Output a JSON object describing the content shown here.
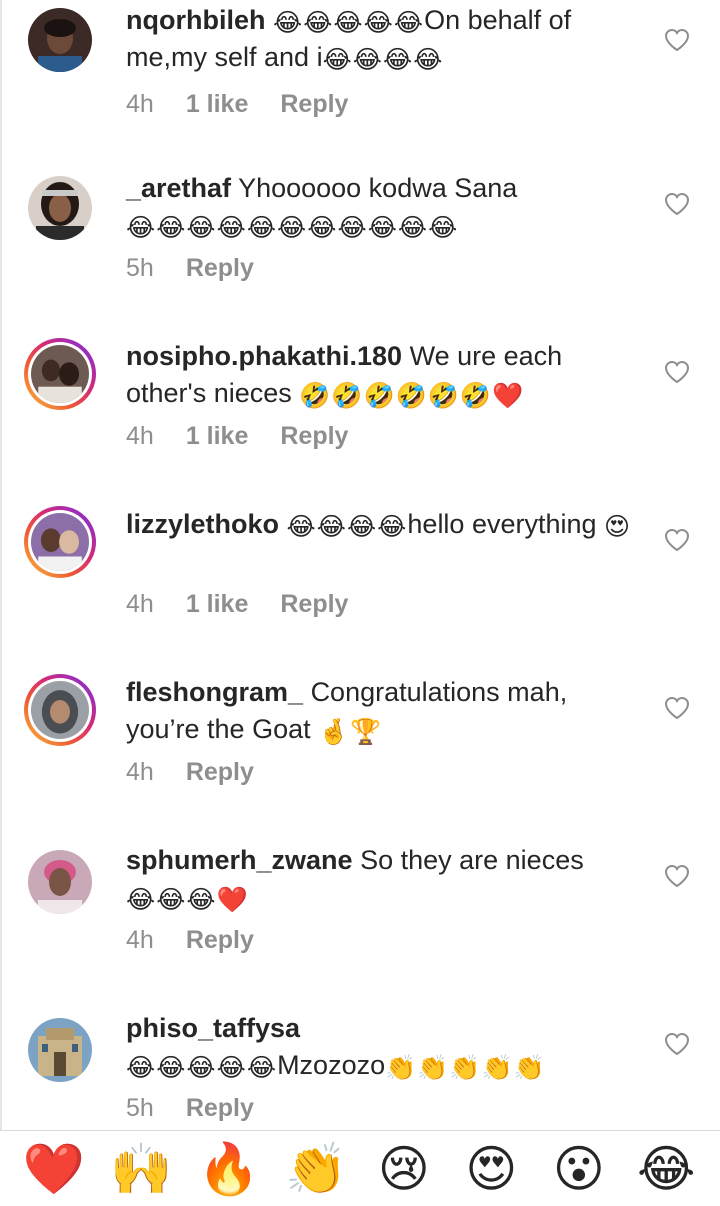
{
  "comments": [
    {
      "username": "nqorhbileh",
      "text_before": " ",
      "emoji_before": "😂😂😂😂😂",
      "text": "On behalf of me,my self and i",
      "emoji_after": "😂😂😂😂",
      "time": "4h",
      "likes": "1 like",
      "reply": "Reply",
      "avatar_icon": "avatar-woman-icon"
    },
    {
      "username": "_arethaf",
      "text_before": " ",
      "emoji_before": "",
      "text": "Yhoooooo kodwa Sana ",
      "emoji_after": "😂😂😂😂😂😂😂😂😂😂😂",
      "time": "5h",
      "likes": "",
      "reply": "Reply",
      "avatar_icon": "avatar-woman-icon"
    },
    {
      "username": "nosipho.phakathi.180",
      "text_before": " ",
      "emoji_before": "",
      "text": "We ure each other's nieces ",
      "emoji_after": "🤣🤣🤣🤣🤣🤣❤️",
      "time": "4h",
      "likes": "1 like",
      "reply": "Reply",
      "avatar_icon": "avatar-couple-icon"
    },
    {
      "username": "lizzylethoko",
      "text_before": " ",
      "emoji_before": "😂😂😂😂",
      "text": "hello everything ",
      "emoji_after": "😍",
      "time": "4h",
      "likes": "1 like",
      "reply": "Reply",
      "avatar_icon": "avatar-selfie-icon"
    },
    {
      "username": "fleshongram_",
      "text_before": " ",
      "emoji_before": "",
      "text": "Congratulations mah, you’re the Goat ",
      "emoji_after": "🤞🏆",
      "time": "4h",
      "likes": "",
      "reply": "Reply",
      "avatar_icon": "avatar-hoodie-icon"
    },
    {
      "username": "sphumerh_zwane",
      "text_before": " ",
      "emoji_before": "",
      "text": "So they are nieces",
      "emoji_after": "😂😂😂❤️",
      "time": "4h",
      "likes": "",
      "reply": "Reply",
      "avatar_icon": "avatar-woman-icon"
    },
    {
      "username": "phiso_taffysa",
      "text_before": " ",
      "emoji_before": "",
      "text": "",
      "emoji_after": "😂😂😂😂😂",
      "text_tail": "Mzozozo",
      "emoji_tail": "👏👏👏👏👏",
      "time": "5h",
      "likes": "",
      "reply": "Reply",
      "avatar_icon": "avatar-building-icon"
    }
  ],
  "quick_reactions": [
    "❤️",
    "🙌",
    "🔥",
    "👏",
    "😢",
    "😍",
    "😮",
    "😂"
  ],
  "colors": {
    "text": "#262626",
    "meta": "#8e8e8e",
    "ring_start": "#f9c23c",
    "ring_end": "#962fbf",
    "heart_outline": "#8e8e8e"
  }
}
